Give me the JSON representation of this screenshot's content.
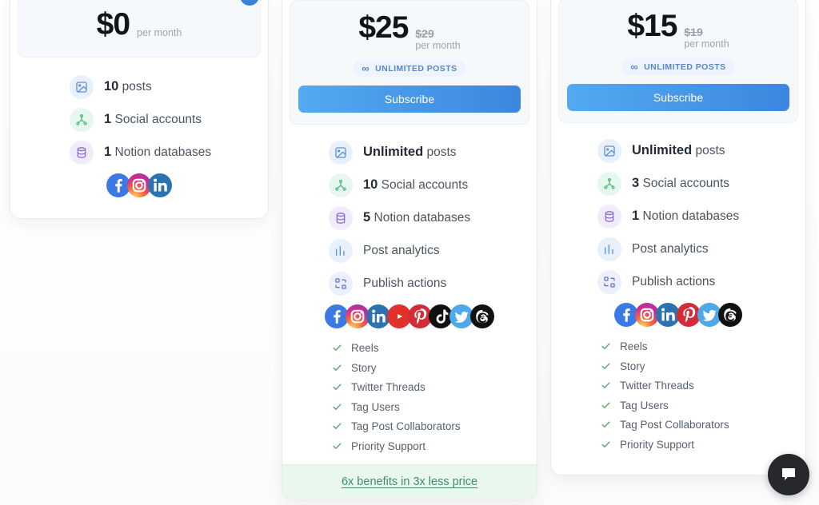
{
  "plans": [
    {
      "id": "free",
      "price": "$0",
      "price_old": "",
      "per": "per month",
      "selected": true,
      "badge": "",
      "cta": "",
      "features": [
        {
          "icon": "image-icon",
          "tone": "blue",
          "strong": "10",
          "label": "posts"
        },
        {
          "icon": "network-icon",
          "tone": "green",
          "strong": "1",
          "label": "Social accounts"
        },
        {
          "icon": "database-icon",
          "tone": "purple",
          "strong": "1",
          "label": "Notion databases"
        }
      ],
      "socials": [
        "facebook",
        "instagram",
        "linkedin"
      ],
      "checklist": []
    },
    {
      "id": "pro",
      "price": "$25",
      "price_old": "$29",
      "per": "per month",
      "selected": false,
      "badge": "UNLIMITED POSTS",
      "badge_symbol": "∞",
      "cta": "Subscribe",
      "features": [
        {
          "icon": "image-icon",
          "tone": "blue",
          "strong": "Unlimited",
          "label": "posts"
        },
        {
          "icon": "network-icon",
          "tone": "green",
          "strong": "10",
          "label": "Social accounts"
        },
        {
          "icon": "database-icon",
          "tone": "purple",
          "strong": "5",
          "label": "Notion databases"
        },
        {
          "icon": "analytics-icon",
          "tone": "blue",
          "strong": "",
          "label": "Post analytics"
        },
        {
          "icon": "publish-icon",
          "tone": "indigo",
          "strong": "",
          "label": "Publish actions"
        }
      ],
      "socials": [
        "facebook",
        "instagram",
        "linkedin",
        "youtube",
        "pinterest",
        "tiktok",
        "twitter",
        "threads"
      ],
      "checklist": [
        "Reels",
        "Story",
        "Twitter Threads",
        "Tag Users",
        "Tag Post Collaborators",
        "Priority Support"
      ],
      "promo": "6x benefits in 3x less price"
    },
    {
      "id": "standard",
      "price": "$15",
      "price_old": "$19",
      "per": "per month",
      "selected": false,
      "badge": "UNLIMITED POSTS",
      "badge_symbol": "∞",
      "cta": "Subscribe",
      "features": [
        {
          "icon": "image-icon",
          "tone": "blue",
          "strong": "Unlimited",
          "label": "posts"
        },
        {
          "icon": "network-icon",
          "tone": "green",
          "strong": "3",
          "label": "Social accounts"
        },
        {
          "icon": "database-icon",
          "tone": "purple",
          "strong": "1",
          "label": "Notion databases"
        },
        {
          "icon": "analytics-icon",
          "tone": "blue",
          "strong": "",
          "label": "Post analytics"
        },
        {
          "icon": "publish-icon",
          "tone": "indigo",
          "strong": "",
          "label": "Publish actions"
        }
      ],
      "socials": [
        "facebook",
        "instagram",
        "linkedin",
        "pinterest",
        "twitter",
        "threads"
      ],
      "checklist": [
        "Reels",
        "Story",
        "Twitter Threads",
        "Tag Users",
        "Tag Post Collaborators",
        "Priority Support"
      ]
    }
  ],
  "chat": {
    "icon": "chat-bubble-icon"
  },
  "colors": {
    "accent": "#3d86e0",
    "accent_light": "#53aaf0",
    "check_green": "#5aa86f",
    "promo_bg": "#e9f7ef",
    "promo_text": "#3f8f66",
    "panel_bg": "#f6f9fc"
  }
}
